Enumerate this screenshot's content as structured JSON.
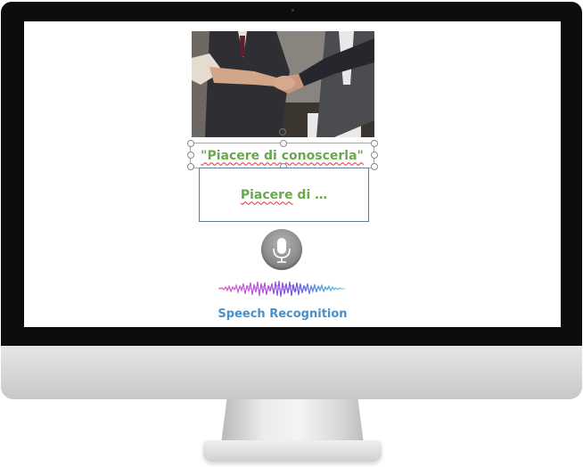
{
  "app": {
    "spoken_phrase": "\"Piacere di conoscerla\"",
    "transcript_prefix": "Piacere",
    "transcript_suffix": " di …",
    "caption": "Speech Recognition"
  },
  "icons": {
    "microphone": "microphone-icon",
    "waveform": "audio-waveform-icon",
    "photo": "handshake-photo"
  },
  "colors": {
    "phrase_text": "#6aa84f",
    "caption_text": "#4a90c8",
    "spellcheck_underline": "#e03030",
    "result_border": "#5b7fa3",
    "mic_button": "#8a8a8a"
  }
}
